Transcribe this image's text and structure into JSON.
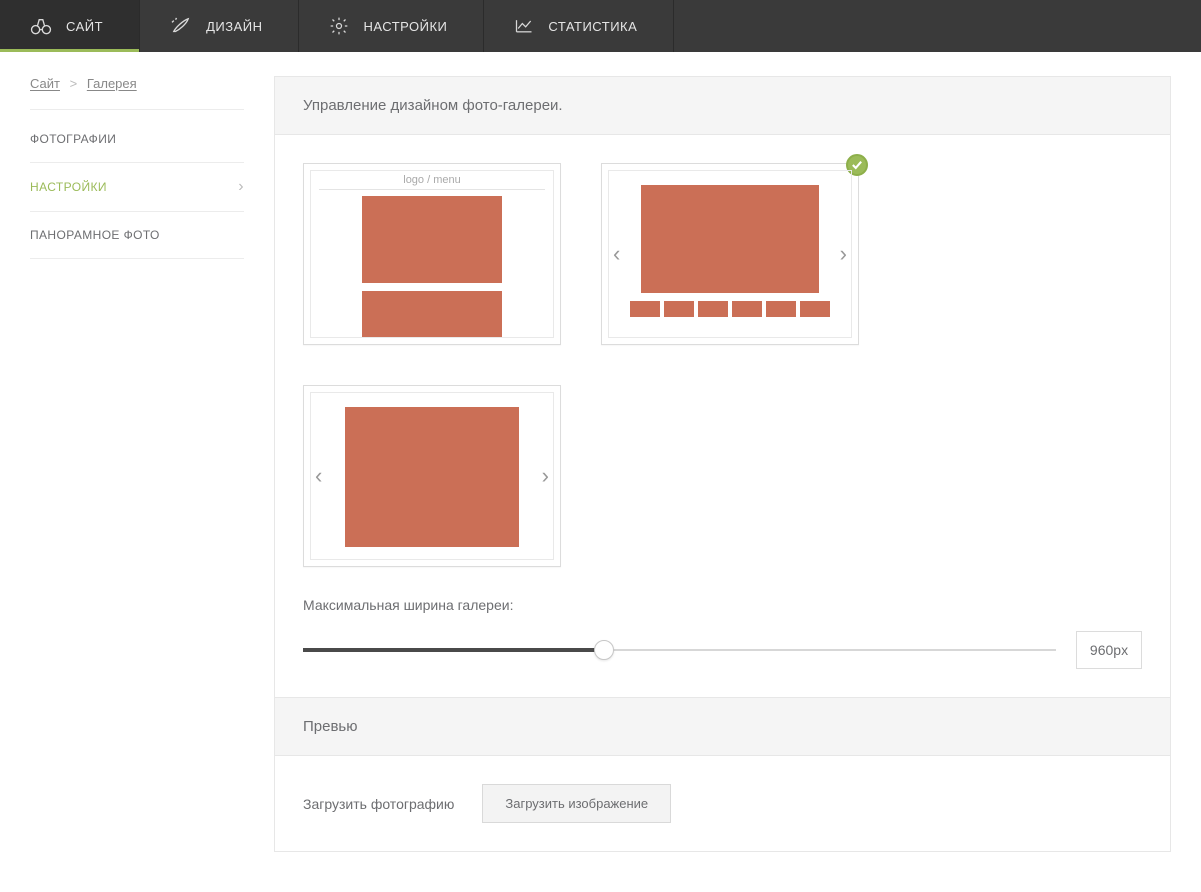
{
  "topnav": {
    "items": [
      {
        "label": "САЙТ",
        "icon": "site"
      },
      {
        "label": "ДИЗАЙН",
        "icon": "design"
      },
      {
        "label": "НАСТРОЙКИ",
        "icon": "settings"
      },
      {
        "label": "СТАТИСТИКА",
        "icon": "stats"
      }
    ]
  },
  "breadcrumb": {
    "root": "Сайт",
    "sep": ">",
    "current": "Галерея"
  },
  "sidemenu": {
    "items": [
      {
        "label": "ФОТОГРАФИИ"
      },
      {
        "label": "НАСТРОЙКИ"
      },
      {
        "label": "ПАНОРАМНОЕ ФОТО"
      }
    ]
  },
  "panel": {
    "title": "Управление дизайном фото-галереи.",
    "card1_label": "logo / menu",
    "selected_index": 1,
    "slider_label": "Максимальная ширина галереи:",
    "slider_value": "960px",
    "sub_title": "Превью",
    "upload_label": "Загрузить фотографию",
    "upload_button": "Загрузить изображение"
  },
  "colors": {
    "accent": "#9bbb59",
    "swatch": "#cb6f56"
  }
}
